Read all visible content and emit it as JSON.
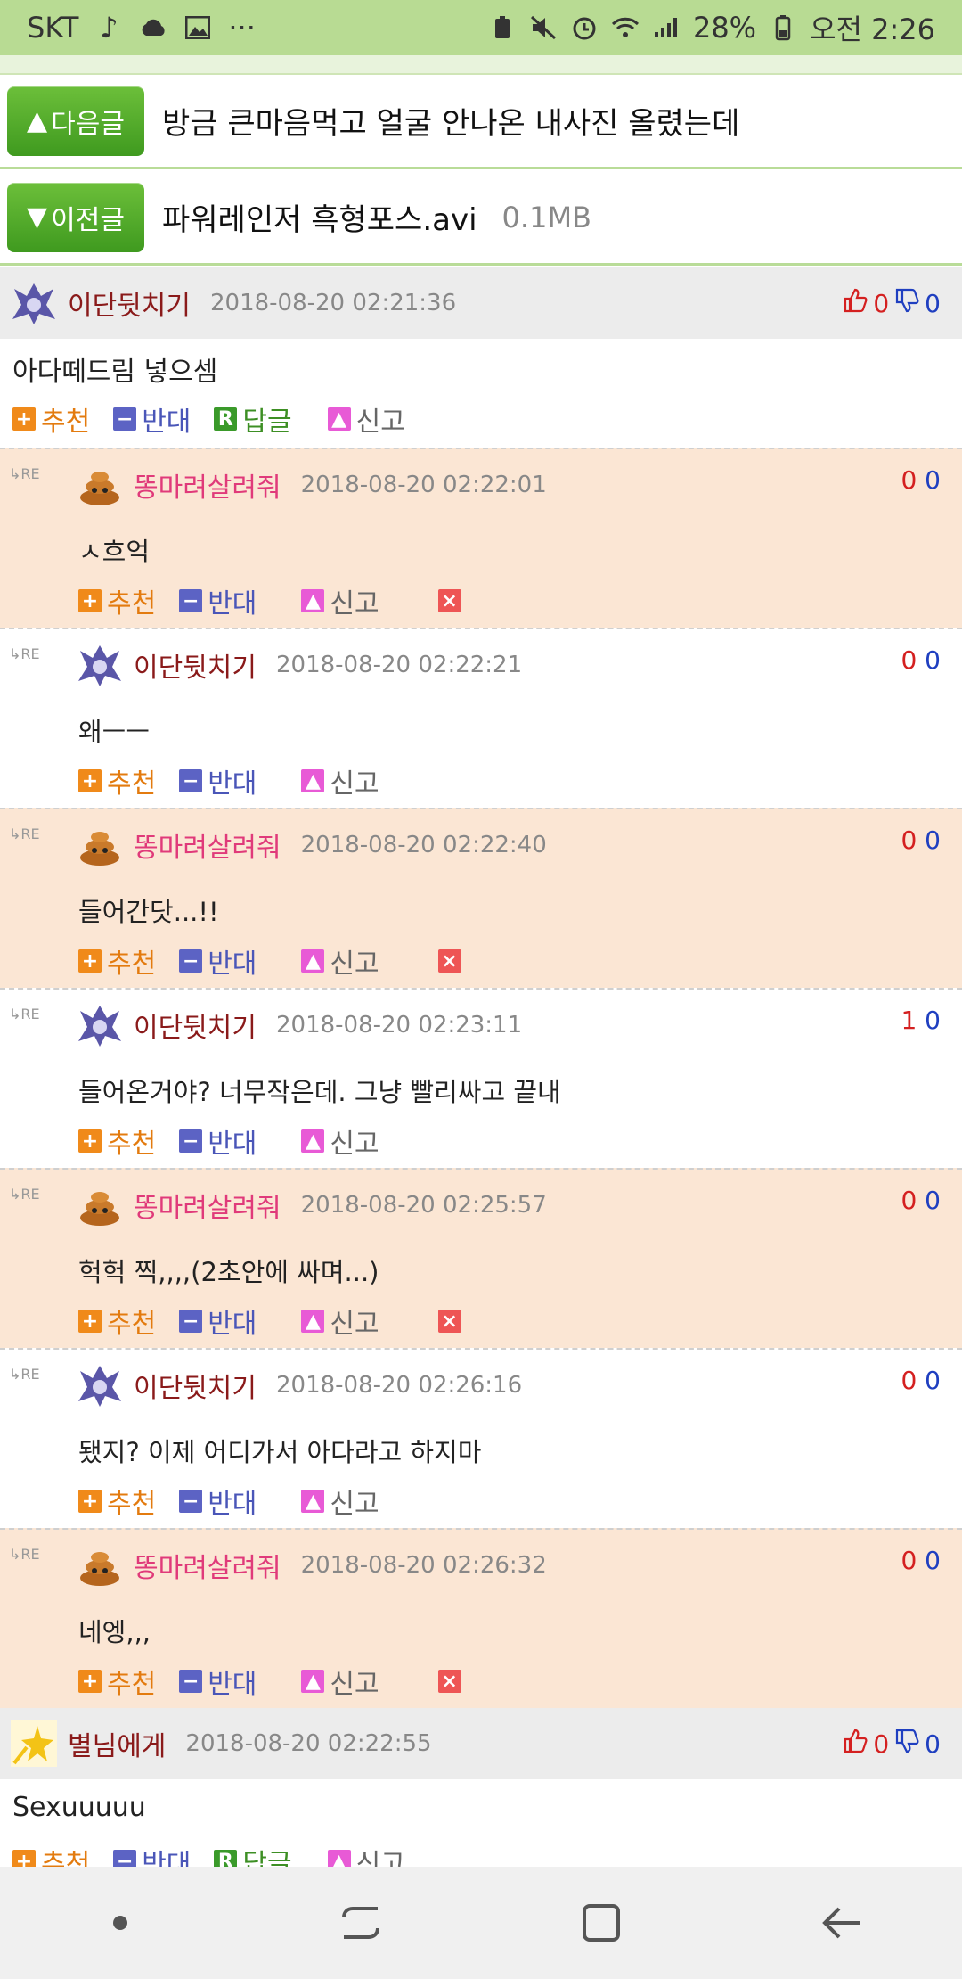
{
  "status_bar": {
    "carrier": "SKT",
    "more": "···",
    "battery_percent": "28%",
    "time": "오전 2:26"
  },
  "nav": {
    "next_label": "다음글",
    "next_title": "방금 큰마음먹고 얼굴 안나온 내사진 올렸는데",
    "prev_label": "이전글",
    "prev_title": "파워레인저 흑형포스.avi",
    "prev_size": "0.1MB"
  },
  "labels": {
    "recommend": "추천",
    "oppose": "반대",
    "reply": "답글",
    "report": "신고",
    "re": "RE"
  },
  "comments": [
    {
      "nick": "이단뒷치기",
      "time": "2018-08-20 02:21:36",
      "up": "0",
      "down": "0",
      "text": "아다떼드림 넣으셈",
      "replies": [
        {
          "nick": "똥마려살려줘",
          "time": "2018-08-20 02:22:01",
          "up": "0",
          "down": "0",
          "text": "ㅅ흐억"
        },
        {
          "nick": "이단뒷치기",
          "time": "2018-08-20 02:22:21",
          "up": "0",
          "down": "0",
          "text": "왜ㅡㅡ"
        },
        {
          "nick": "똥마려살려줘",
          "time": "2018-08-20 02:22:40",
          "up": "0",
          "down": "0",
          "text": "들어간닷...!!"
        },
        {
          "nick": "이단뒷치기",
          "time": "2018-08-20 02:23:11",
          "up": "1",
          "down": "0",
          "text": "들어온거야? 너무작은데. 그냥 빨리싸고 끝내"
        },
        {
          "nick": "똥마려살려줘",
          "time": "2018-08-20 02:25:57",
          "up": "0",
          "down": "0",
          "text": "헉헉 찍,,,,(2초안에 싸며...)"
        },
        {
          "nick": "이단뒷치기",
          "time": "2018-08-20 02:26:16",
          "up": "0",
          "down": "0",
          "text": "됐지? 이제 어디가서 아다라고 하지마"
        },
        {
          "nick": "똥마려살려줘",
          "time": "2018-08-20 02:26:32",
          "up": "0",
          "down": "0",
          "text": "네엥,,,"
        }
      ]
    },
    {
      "nick": "별님에게",
      "time": "2018-08-20 02:22:55",
      "up": "0",
      "down": "0",
      "text": "Sexuuuuu"
    }
  ],
  "icons": {
    "gear_ocean_avatar": "robot-avatar-icon",
    "poop_avatar": "poop-avatar-icon",
    "star_avatar": "star-avatar-icon"
  }
}
